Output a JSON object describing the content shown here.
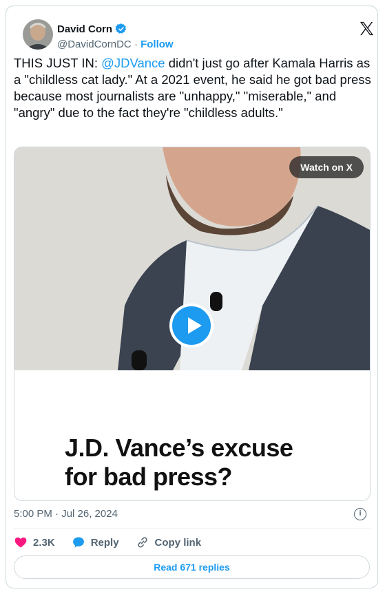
{
  "author": {
    "name": "David Corn",
    "handle": "@DavidCornDC",
    "separator": "·",
    "follow_label": "Follow",
    "verified": true
  },
  "tweet": {
    "text_before": "THIS JUST IN: ",
    "mention": "@JDVance",
    "text_after": " didn't just go after Kamala Harris as a \"childless cat lady.\" At a 2021 event, he said he got bad press because most journalists are \"unhappy,\" \"miserable,\" and \"angry\" due to the fact they're \"childless adults.\""
  },
  "media": {
    "watch_label": "Watch on X",
    "caption_line1": "J.D. Vance’s excuse",
    "caption_line2": "for bad press?"
  },
  "meta": {
    "timestamp": "5:00 PM · Jul 26, 2024"
  },
  "actions": {
    "like_count": "2.3K",
    "reply_label": "Reply",
    "copy_label": "Copy link",
    "read_replies_label": "Read 671 replies"
  },
  "colors": {
    "accent": "#1d9bf0",
    "like": "#f91880",
    "text": "#0f1419",
    "muted": "#536471"
  },
  "icons": [
    "verified-badge-icon",
    "x-logo-icon",
    "play-icon",
    "info-icon",
    "heart-icon",
    "reply-bubble-icon",
    "link-icon"
  ]
}
